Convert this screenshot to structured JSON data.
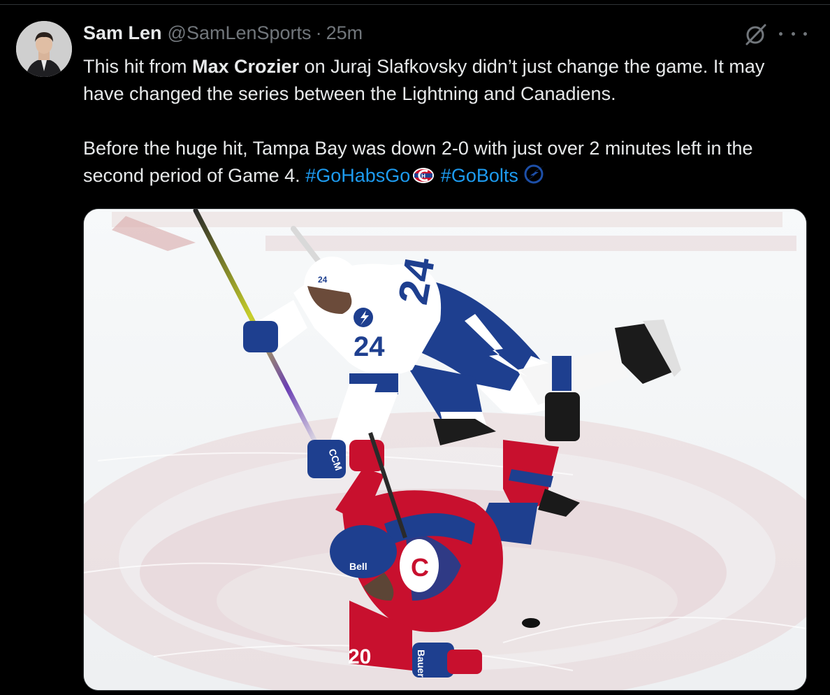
{
  "tweet": {
    "author_name": "Sam Len",
    "handle": "@SamLenSports",
    "separator": "·",
    "time": "25m",
    "paragraph1": {
      "before": "This hit from ",
      "bold": "Max Crozier",
      "after": " on Juraj Slafkovsky didn’t just change the game. It may have changed the series between the Lightning and Canadiens."
    },
    "paragraph2": {
      "text": "Before the huge hit, Tampa Bay was down 2-0 with just over 2 minutes left in the second period of Game 4. ",
      "hashtag1": "#GoHabsGo",
      "hashtag2": "#GoBolts"
    }
  },
  "photo": {
    "player_top_number": "24",
    "player_bottom_number": "20",
    "helmet_sponsor": "Bell",
    "glove_brand": "CCM",
    "stick_brand": "Bauer"
  },
  "colors": {
    "background": "#000000",
    "text": "#e7e9ea",
    "secondary": "#71767b",
    "link": "#1d9bf0",
    "lightning_blue": "#1e3f8f",
    "canadiens_red": "#c8102e"
  },
  "icons": [
    "grok-icon",
    "more-icon",
    "habs-logo-icon",
    "bolts-logo-icon"
  ]
}
